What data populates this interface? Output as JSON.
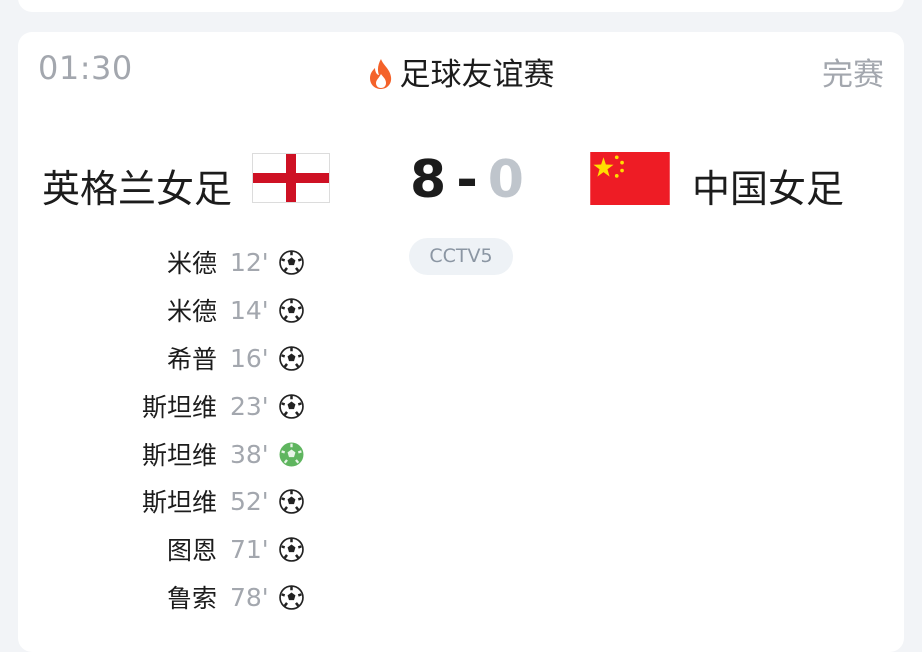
{
  "match": {
    "time": "01:30",
    "league": "足球友谊赛",
    "status": "完赛",
    "home": {
      "name": "英格兰女足",
      "score": "8"
    },
    "away": {
      "name": "中国女足",
      "score": "0"
    },
    "score_separator": "-",
    "channel": "CCTV5"
  },
  "goals": [
    {
      "scorer": "米德",
      "minute": "12'",
      "type": "goal"
    },
    {
      "scorer": "米德",
      "minute": "14'",
      "type": "goal"
    },
    {
      "scorer": "希普",
      "minute": "16'",
      "type": "goal"
    },
    {
      "scorer": "斯坦维",
      "minute": "23'",
      "type": "goal"
    },
    {
      "scorer": "斯坦维",
      "minute": "38'",
      "type": "penalty"
    },
    {
      "scorer": "斯坦维",
      "minute": "52'",
      "type": "goal"
    },
    {
      "scorer": "图恩",
      "minute": "71'",
      "type": "goal"
    },
    {
      "scorer": "鲁索",
      "minute": "78'",
      "type": "goal"
    }
  ],
  "icons": {
    "league": "flame-icon",
    "goal": "soccer-ball-icon",
    "penalty": "penalty-goal-icon"
  },
  "colors": {
    "flame": "#f4622a",
    "england_red": "#ce1124",
    "china_red": "#ee1c25",
    "china_star": "#ffde00",
    "penalty_green": "#5fb55f",
    "muted_text": "#a3a7ae"
  }
}
